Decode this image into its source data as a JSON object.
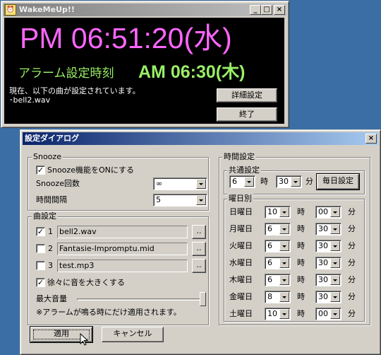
{
  "main_window": {
    "title": "WakeMeUp!!",
    "clock": "PM 06:51:20(水)",
    "alarm_label": "アラーム設定時刻",
    "alarm_time": "AM 06:30(木)",
    "status_line": "現在、以下の曲が設定されています。",
    "song_line": "･bell2.wav",
    "detail_button": "詳細設定",
    "quit_button": "終了"
  },
  "dialog": {
    "title": "設定ダイアログ",
    "snooze": {
      "group_label": "Snooze",
      "enable_label": "Snooze機能をONにする",
      "enable_checked": true,
      "count_label": "Snooze回数",
      "count_value": "∞",
      "interval_label": "時間間隔",
      "interval_value": "5"
    },
    "songs": {
      "group_label": "曲設定",
      "items": [
        {
          "index": "1",
          "file": "bell2.wav",
          "checked": true,
          "browse": ".."
        },
        {
          "index": "2",
          "file": "Fantasie-Impromptu.mid",
          "checked": false,
          "browse": ".."
        },
        {
          "index": "3",
          "file": "test.mp3",
          "checked": false,
          "browse": ".."
        }
      ],
      "fade_label": "徐々に音を大きくする",
      "fade_checked": true,
      "volume_label": "最大音量",
      "volume_level": 1.0,
      "note": "※アラームが鳴る時にだけ適用されます。"
    },
    "time": {
      "group_label": "時間設定",
      "common_label": "共通設定",
      "common_hour": "6",
      "hour_unit": "時",
      "common_minute": "30",
      "minute_unit": "分",
      "everyday_button": "毎日設定",
      "daily_label": "曜日別",
      "days": [
        {
          "day": "日曜日",
          "hour": "10",
          "minute": "00"
        },
        {
          "day": "月曜日",
          "hour": "6",
          "minute": "30"
        },
        {
          "day": "火曜日",
          "hour": "6",
          "minute": "30"
        },
        {
          "day": "水曜日",
          "hour": "6",
          "minute": "30"
        },
        {
          "day": "木曜日",
          "hour": "6",
          "minute": "30"
        },
        {
          "day": "金曜日",
          "hour": "8",
          "minute": "30"
        },
        {
          "day": "土曜日",
          "hour": "10",
          "minute": "00"
        }
      ]
    },
    "apply_button": "適用",
    "cancel_button": "キャンセル"
  },
  "colors": {
    "clock": "#ff66ff",
    "alarm": "#99ee66",
    "desktop": "#3a6ea5"
  }
}
